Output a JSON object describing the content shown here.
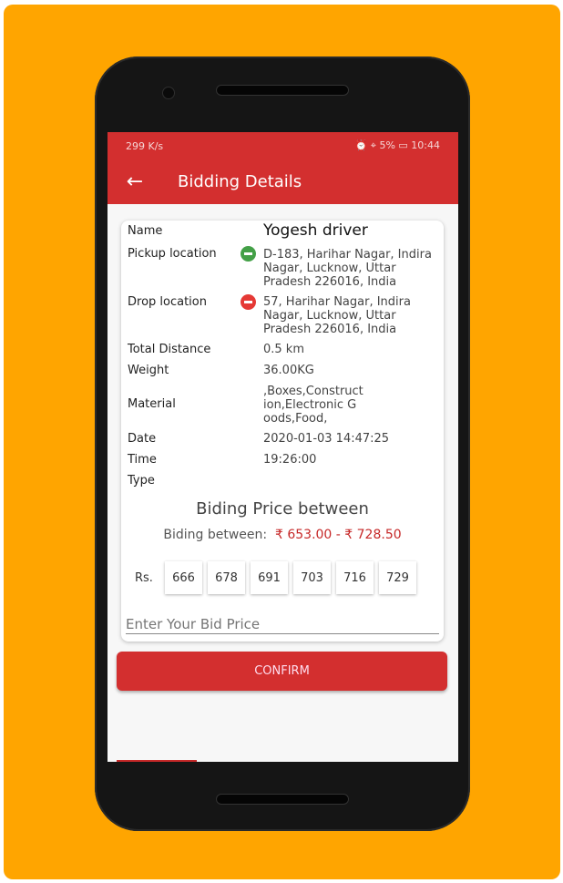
{
  "status": {
    "left": "299 K/s",
    "right": "⏰ ⌖ 5% ▭ 10:44"
  },
  "appbar": {
    "back_icon": "arrow-left",
    "title": "Bidding Details"
  },
  "details": {
    "name_label": "Name",
    "name": "Yogesh driver",
    "pickup_label": "Pickup location",
    "pickup": "D-183, Harihar Nagar, Indira Nagar, Lucknow, Uttar Pradesh 226016, India",
    "drop_label": "Drop location",
    "drop": "57, Harihar Nagar, Indira Nagar, Lucknow, Uttar Pradesh 226016, India",
    "distance_label": "Total Distance",
    "distance": "0.5 km",
    "weight_label": "Weight",
    "weight": "36.00KG",
    "material_label": "Material",
    "material": ",Boxes,Construction,Electronic Goods,Food,",
    "date_label": "Date",
    "date": "2020-01-03 14:47:25",
    "time_label": "Time",
    "time": "19:26:00",
    "type_label": "Type"
  },
  "bid": {
    "heading": "Biding Price between",
    "range_label": "Biding between:",
    "range": "₹ 653.00 - ₹ 728.50",
    "rs": "Rs.",
    "options": [
      "666",
      "678",
      "691",
      "703",
      "716",
      "729"
    ],
    "placeholder": "Enter Your Bid Price",
    "value": ""
  },
  "confirm_label": "CONFIRM",
  "colors": {
    "primary": "#D32F2F",
    "background": "#FFA500",
    "pickup": "#43A047",
    "drop": "#E53935"
  }
}
